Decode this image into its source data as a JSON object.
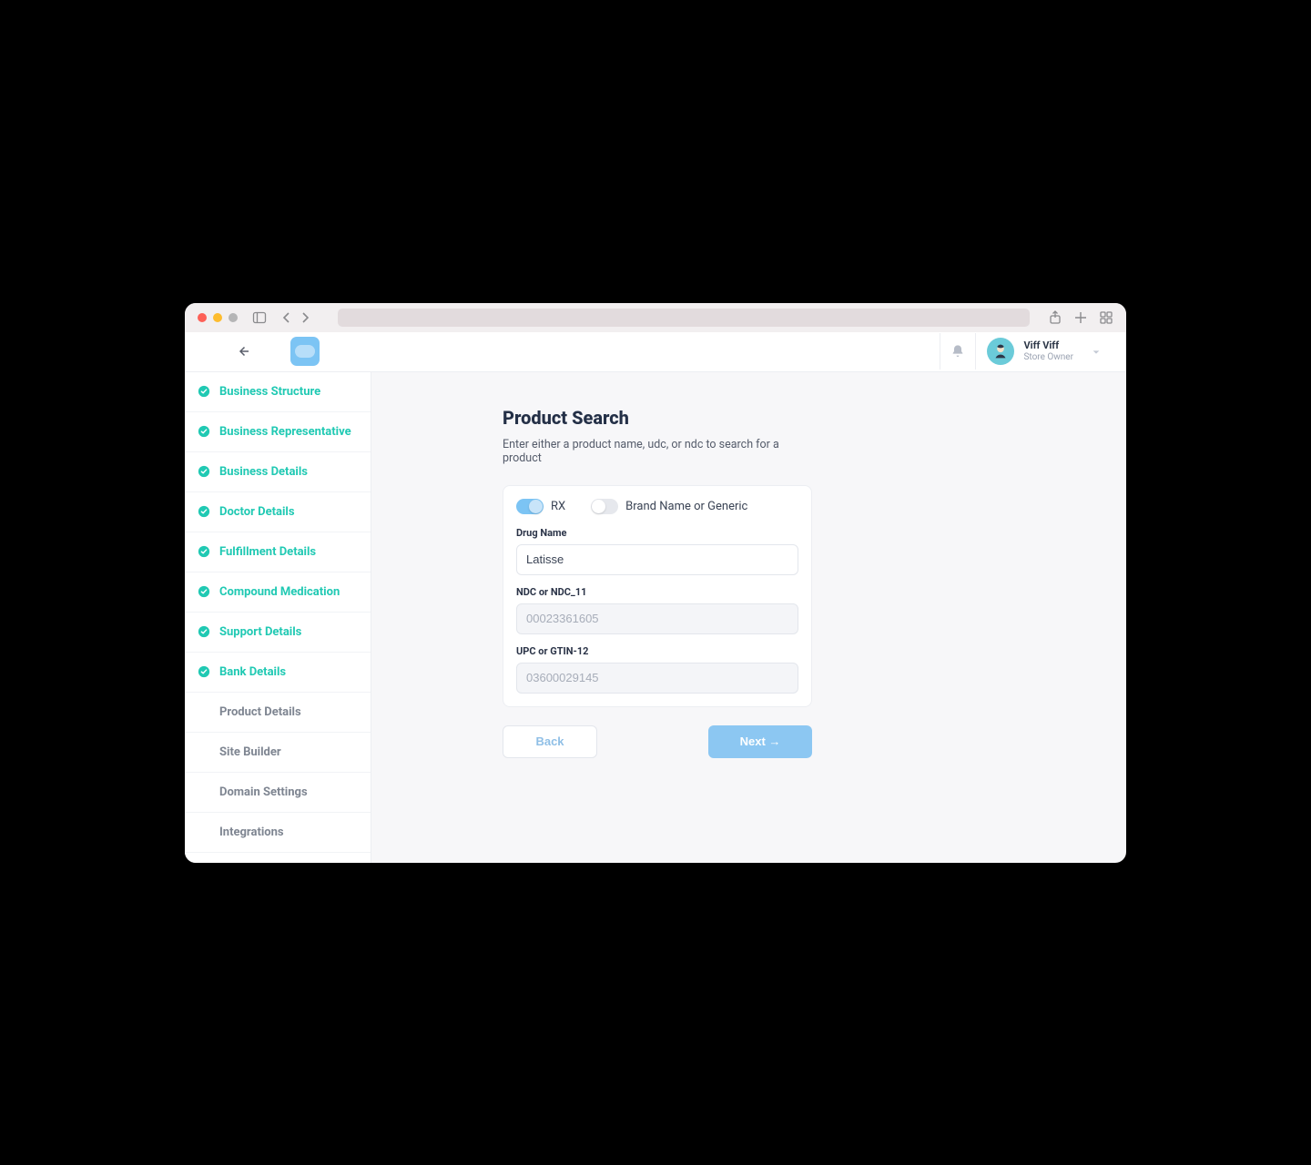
{
  "header": {
    "user_name": "Viff Viff",
    "user_role": "Store Owner"
  },
  "sidebar": {
    "items": [
      {
        "label": "Business Structure",
        "complete": true
      },
      {
        "label": "Business Representative",
        "complete": true
      },
      {
        "label": "Business Details",
        "complete": true
      },
      {
        "label": "Doctor Details",
        "complete": true
      },
      {
        "label": "Fulfillment Details",
        "complete": true
      },
      {
        "label": "Compound Medication",
        "complete": true
      },
      {
        "label": "Support Details",
        "complete": true
      },
      {
        "label": "Bank Details",
        "complete": true
      },
      {
        "label": "Product Details",
        "complete": false
      },
      {
        "label": "Site Builder",
        "complete": false
      },
      {
        "label": "Domain Settings",
        "complete": false
      },
      {
        "label": "Integrations",
        "complete": false
      }
    ]
  },
  "main": {
    "title": "Product Search",
    "subtitle": "Enter either a product name, udc, or ndc to search for a product",
    "toggles": {
      "rx_label": "RX",
      "brand_label": "Brand Name or Generic"
    },
    "fields": {
      "drug_name": {
        "label": "Drug Name",
        "value": "Latisse"
      },
      "ndc": {
        "label": "NDC or NDC_11",
        "placeholder": "00023361605"
      },
      "upc": {
        "label": "UPC or GTIN-12",
        "placeholder": "03600029145"
      }
    },
    "buttons": {
      "back": "Back",
      "next": "Next →"
    }
  }
}
